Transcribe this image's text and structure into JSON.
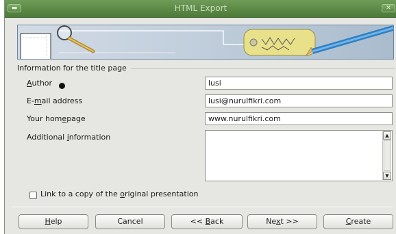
{
  "window": {
    "title": "HTML Export"
  },
  "titlebar": {
    "menu_glyph": "▬",
    "close_glyph": "✕"
  },
  "banner": {
    "left_icon": "magnifier-over-page-illustration",
    "right_icon": "tag-and-pencil-illustration"
  },
  "section": {
    "title": "Information for the title page"
  },
  "fields": {
    "author": {
      "label_mnemonic": "A",
      "label_rest": "uthor",
      "value": "lusi"
    },
    "email": {
      "label_pre": "E-",
      "label_mnemonic": "m",
      "label_rest": "ail address",
      "value": "lusi@nurulfikri.com"
    },
    "homepage": {
      "label_pre": "Your hom",
      "label_mnemonic": "e",
      "label_rest": "page",
      "value": "www.nurulfikri.com"
    },
    "additional": {
      "label_pre": "Additional ",
      "label_mnemonic": "i",
      "label_rest": "nformation",
      "value": ""
    }
  },
  "checkbox": {
    "label_pre": "Link to a copy of the ",
    "label_mnemonic": "o",
    "label_rest": "riginal presentation",
    "checked": false
  },
  "buttons": {
    "help": {
      "pre": "",
      "mn": "H",
      "rest": "elp"
    },
    "cancel": {
      "pre": "Cancel",
      "mn": "",
      "rest": ""
    },
    "back": {
      "pre": "<< ",
      "mn": "B",
      "rest": "ack"
    },
    "next": {
      "pre": "Ne",
      "mn": "x",
      "rest": "t >>"
    },
    "create": {
      "pre": "",
      "mn": "C",
      "rest": "reate"
    }
  },
  "scrollbar": {
    "up_glyph": "▲",
    "down_glyph": "▼"
  }
}
